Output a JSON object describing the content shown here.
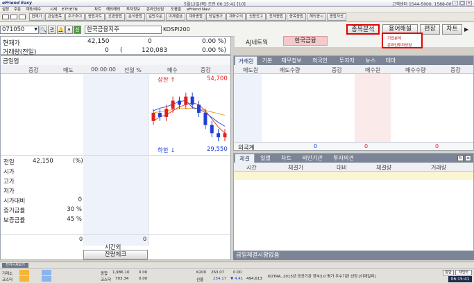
{
  "titlebar": {
    "app_name": "eFriend Easy",
    "center_text": "5월12일(목) 오전 06:15:41 [10]",
    "right_text": "고객센터 1544-5000, 1588-0012"
  },
  "menu": [
    "설정",
    "주문",
    "계좌/예수",
    "시세",
    "ETF/ETN",
    "차트",
    "해외해외",
    "투자정보",
    "온라인상담",
    "도움말",
    "eFriend Navi"
  ],
  "toolbar_buttons": [
    "현재가",
    "관심종목",
    "주가추이",
    "종합차트",
    "간편종합",
    "분석종합",
    "일반주문",
    "미체결금",
    "계좌종합",
    "당일평가",
    "계좌수익",
    "신용잔고",
    "잔체종합",
    "종목종합",
    "해외종시",
    "종합자산"
  ],
  "stock": {
    "code": "071050",
    "code_label": "관",
    "name": "한국금융지주",
    "index": "KOSPI200",
    "sector": "AJ네트웍",
    "related": "한국금융"
  },
  "top_buttons": {
    "analysis": "종목분석",
    "terms": "용어해설",
    "edit": "편장",
    "chart": "차트"
  },
  "popup": {
    "item1": "기업분석",
    "item2": "온라인투자상담"
  },
  "price": {
    "current_label": "현재가",
    "current_value": "42,150",
    "change": "0",
    "change_pct": "0.00 %)",
    "volume_label": "거래량(전일)",
    "volume": "0",
    "volume_prev": "120,083",
    "volume_pct": "0.00 %)"
  },
  "orderbook": {
    "title": "금일업",
    "headers": [
      "증감",
      "매도",
      "00:00:00",
      "전일 %",
      "매수",
      "증감"
    ],
    "upper_label": "상한 ↑",
    "upper_value": "54,700",
    "lower_label": "하한 ↓",
    "lower_value": "29,550"
  },
  "stats": [
    {
      "label": "전일",
      "value": "42,150",
      "extra": "(%)"
    },
    {
      "label": "시가",
      "value": "",
      "extra": ""
    },
    {
      "label": "고가",
      "value": "",
      "extra": ""
    },
    {
      "label": "저가",
      "value": "",
      "extra": ""
    },
    {
      "label": "시가대비",
      "value": "0",
      "extra": ""
    },
    {
      "label": "증거금률",
      "value": "30 %",
      "extra": ""
    },
    {
      "label": "보증금률",
      "value": "45 %",
      "extra": ""
    }
  ],
  "bottom_left": {
    "val_a": "0",
    "val_b": "0",
    "after_hours": "시간외",
    "balance_btn": "잔량체크"
  },
  "broker": {
    "tabs": [
      "거래원",
      "기본",
      "재무정보",
      "외국인",
      "투자자",
      "뉴스",
      "테마"
    ],
    "headers": [
      "매도원",
      "매도수량",
      "증감",
      "매수원",
      "매수수량",
      "증감"
    ],
    "foreign_label": "외국계",
    "foreign_sell": "0",
    "foreign_mid": "0",
    "foreign_buy": "0"
  },
  "trades": {
    "tabs": [
      "체결",
      "일별",
      "차트",
      "외인기관",
      "투자의견"
    ],
    "headers": [
      "시간",
      "체결가",
      "대비",
      "체결량",
      "거래량"
    ]
  },
  "news_ticker": "금일체결시황없음",
  "status": {
    "left_btn": "전자시세보기",
    "row1_label": "거래소",
    "row2_label": "코스닥",
    "kospi_label": "종합",
    "kospi_val": "1,986.10",
    "kospi_chg": "0.00",
    "kosdaq_label": "코스닥",
    "kosdaq_val": "703.34",
    "kosdaq_chg": "0.00",
    "k200_label": "K200",
    "k200_val": "263.07",
    "k200_chg": "0.00",
    "sub_label": "선물",
    "sub_val": "254.17",
    "sub_chg": "▼ 4.41",
    "sub_vol": "494,613",
    "news": "KOTRA, 2015년 공공기관 정부3.0 평가 우수기관 선정 [이데일리]",
    "time_btn": "06:15:41",
    "btn_a": "통합",
    "btn_b": "재입력"
  },
  "chart_data": {
    "type": "candlestick",
    "candles": [
      {
        "o": 47,
        "c": 49,
        "h": 50,
        "l": 46
      },
      {
        "o": 49,
        "c": 48,
        "h": 50,
        "l": 47
      },
      {
        "o": 48,
        "c": 50,
        "h": 51,
        "l": 47
      },
      {
        "o": 50,
        "c": 52,
        "h": 53,
        "l": 49
      },
      {
        "o": 52,
        "c": 51,
        "h": 53,
        "l": 50
      },
      {
        "o": 51,
        "c": 53,
        "h": 54,
        "l": 50
      },
      {
        "o": 53,
        "c": 51,
        "h": 54,
        "l": 50
      },
      {
        "o": 51,
        "c": 49,
        "h": 52,
        "l": 48
      },
      {
        "o": 49,
        "c": 46,
        "h": 50,
        "l": 45
      },
      {
        "o": 46,
        "c": 44,
        "h": 47,
        "l": 43
      },
      {
        "o": 44,
        "c": 43,
        "h": 45,
        "l": 42
      },
      {
        "o": 43,
        "c": 44,
        "h": 45,
        "l": 42
      }
    ],
    "ma_short": [
      47,
      48,
      48.5,
      49.5,
      50.5,
      51,
      51.5,
      51,
      49.5,
      47.5,
      45.5,
      44
    ],
    "ma_long": [
      49,
      49.3,
      49.5,
      49.8,
      50,
      50.1,
      50.1,
      49.9,
      49.6,
      49.2,
      48.8,
      48.4
    ],
    "ylim": [
      41,
      56
    ]
  },
  "colors": {
    "up": "#e02020",
    "down": "#1f3fd8",
    "ma_short": "#e24b2b",
    "ma_long": "#f0a030",
    "ma_third": "#3a5bd8"
  }
}
